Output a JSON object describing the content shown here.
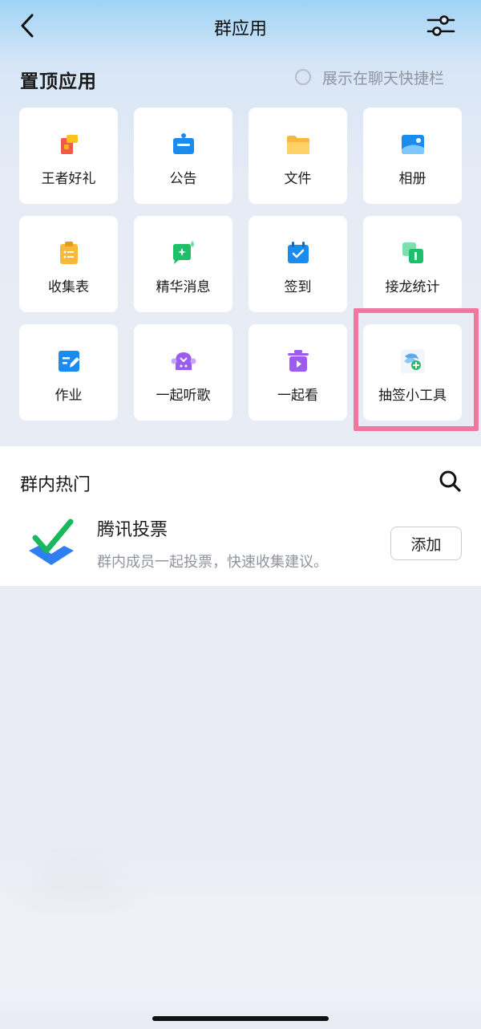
{
  "header": {
    "title": "群应用"
  },
  "pinned": {
    "title": "置顶应用",
    "show_in_chat_label": "展示在聊天快捷栏",
    "apps": [
      {
        "label": "王者好礼",
        "icon": "gift-icon"
      },
      {
        "label": "公告",
        "icon": "announcement-icon"
      },
      {
        "label": "文件",
        "icon": "folder-icon"
      },
      {
        "label": "相册",
        "icon": "album-icon"
      },
      {
        "label": "收集表",
        "icon": "clipboard-icon"
      },
      {
        "label": "精华消息",
        "icon": "essence-message-icon"
      },
      {
        "label": "签到",
        "icon": "checkin-calendar-icon"
      },
      {
        "label": "接龙统计",
        "icon": "relay-stats-icon"
      },
      {
        "label": "作业",
        "icon": "homework-icon"
      },
      {
        "label": "一起听歌",
        "icon": "listen-music-icon"
      },
      {
        "label": "一起看",
        "icon": "watch-together-icon"
      },
      {
        "label": "抽签小工具",
        "icon": "lottery-tool-icon"
      }
    ],
    "colors": {
      "highlight_border": "#f0779e"
    }
  },
  "hot": {
    "title": "群内热门",
    "item": {
      "name": "腾讯投票",
      "description": "群内成员一起投票，快速收集建议。",
      "add_label": "添加",
      "icon": "vote-check-icon"
    }
  }
}
